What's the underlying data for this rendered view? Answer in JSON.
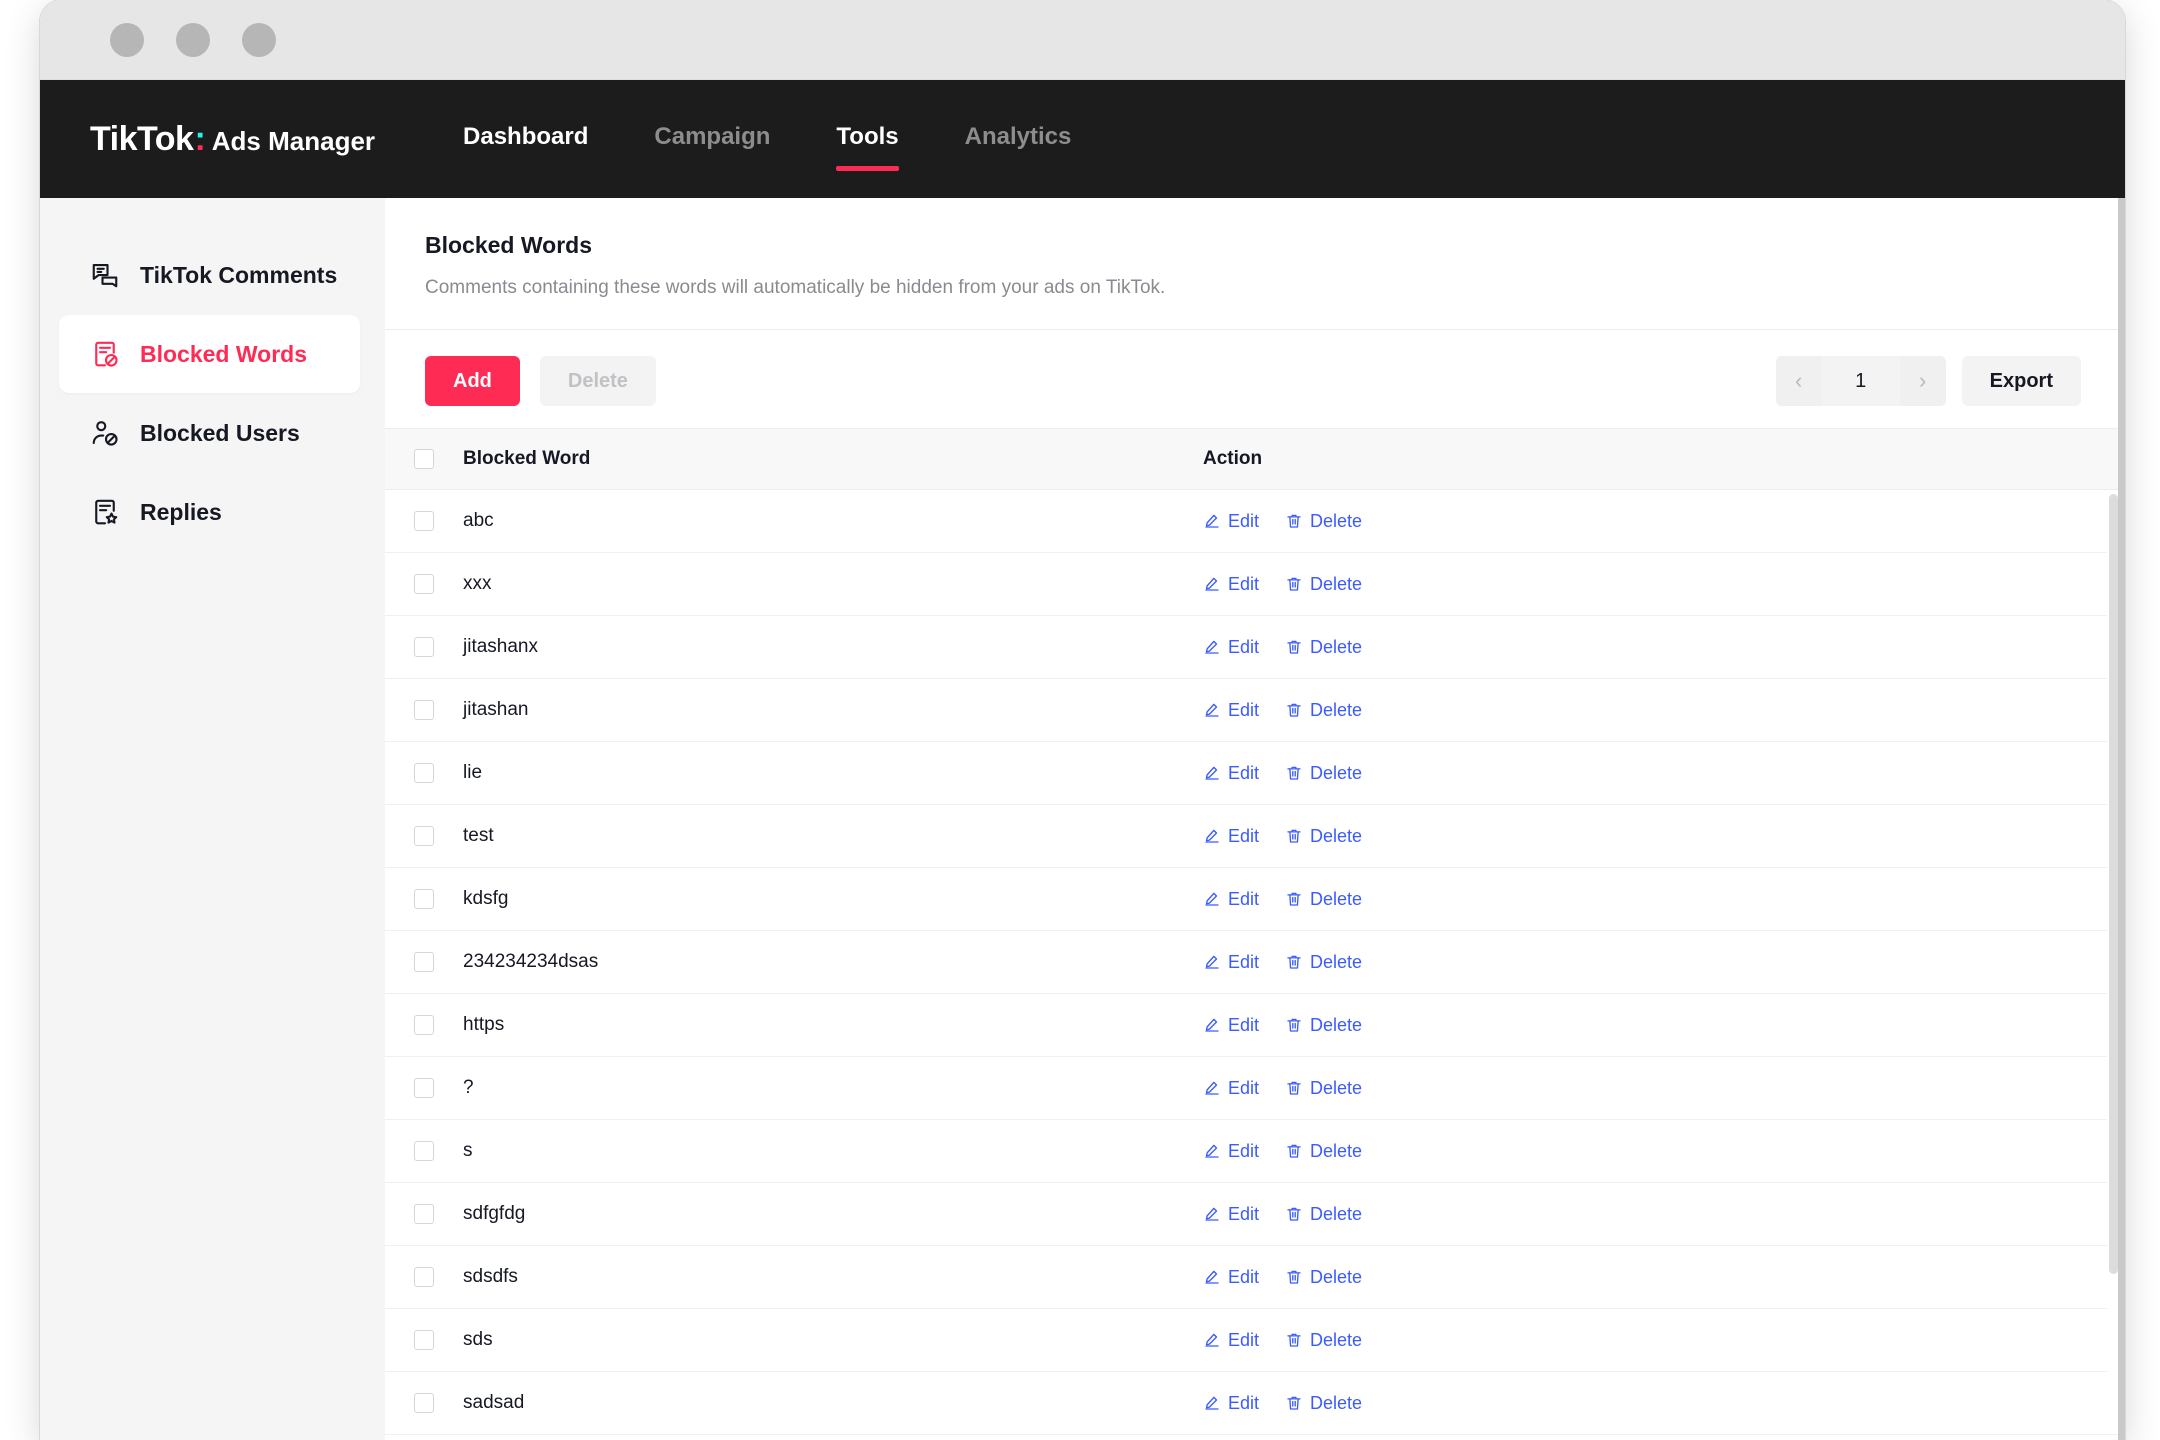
{
  "window": {
    "dots": [
      "close-dot",
      "minimize-dot",
      "maximize-dot"
    ]
  },
  "topnav": {
    "brand_main": "TikTok",
    "brand_colon": ":",
    "brand_suffix": "Ads Manager",
    "items": [
      {
        "label": "Dashboard",
        "state": "white"
      },
      {
        "label": "Campaign",
        "state": "muted"
      },
      {
        "label": "Tools",
        "state": "active"
      },
      {
        "label": "Analytics",
        "state": "muted"
      }
    ],
    "accent": "#FE2C55"
  },
  "sidebar": {
    "items": [
      {
        "label": "TikTok Comments",
        "icon": "comments-icon",
        "active": false
      },
      {
        "label": "Blocked Words",
        "icon": "blocked-words-icon",
        "active": true
      },
      {
        "label": "Blocked Users",
        "icon": "blocked-users-icon",
        "active": false
      },
      {
        "label": "Replies",
        "icon": "replies-icon",
        "active": false
      }
    ]
  },
  "panel": {
    "title": "Blocked Words",
    "subtitle": "Comments containing these words will automatically be hidden from your ads on TikTok."
  },
  "toolbar": {
    "add_label": "Add",
    "delete_label": "Delete",
    "delete_disabled": true,
    "prev_label": "‹",
    "page_value": "1",
    "next_label": "›",
    "export_label": "Export"
  },
  "table": {
    "columns": [
      "Blocked Word",
      "Action"
    ],
    "action_labels": {
      "edit": "Edit",
      "delete": "Delete"
    },
    "rows": [
      {
        "word": "abc"
      },
      {
        "word": "xxx"
      },
      {
        "word": "jitashanx"
      },
      {
        "word": "jitashan"
      },
      {
        "word": "lie"
      },
      {
        "word": "test"
      },
      {
        "word": "kdsfg"
      },
      {
        "word": "234234234dsas"
      },
      {
        "word": "https"
      },
      {
        "word": "?"
      },
      {
        "word": "s"
      },
      {
        "word": "sdfgfdg"
      },
      {
        "word": "sdsdfs"
      },
      {
        "word": "sds"
      },
      {
        "word": "sadsad"
      }
    ]
  },
  "colors": {
    "accent_pink": "#FE2C55",
    "link_blue": "#3B5BFF",
    "topnav_bg": "#1C1C1C",
    "sidebar_bg": "#F5F5F5"
  }
}
